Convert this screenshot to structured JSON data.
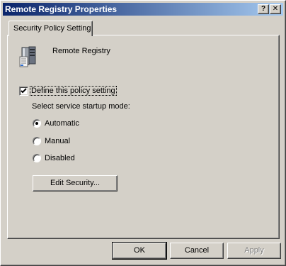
{
  "window": {
    "title": "Remote Registry Properties",
    "help_glyph": "?",
    "close_glyph": "✕"
  },
  "tabs": [
    {
      "label": "Security Policy Setting",
      "selected": true
    }
  ],
  "service": {
    "name": "Remote Registry",
    "icon": "server-icon"
  },
  "policy": {
    "define_label": "Define this policy setting",
    "define_checked": true,
    "mode_label": "Select service startup mode:",
    "options": [
      {
        "label": "Automatic",
        "selected": true
      },
      {
        "label": "Manual",
        "selected": false
      },
      {
        "label": "Disabled",
        "selected": false
      }
    ],
    "edit_security_label": "Edit Security..."
  },
  "footer": {
    "ok_label": "OK",
    "cancel_label": "Cancel",
    "apply_label": "Apply",
    "apply_enabled": false
  },
  "colors": {
    "title_gradient_start": "#0a246a",
    "title_gradient_end": "#a6caf0",
    "face": "#d4d0c8"
  }
}
